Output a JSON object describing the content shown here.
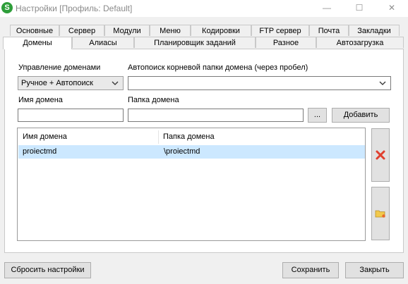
{
  "window": {
    "app_icon_letter": "S",
    "title": "Настройки [Профиль: Default]",
    "minimize_glyph": "—",
    "maximize_glyph": "☐",
    "close_glyph": "✕"
  },
  "tabs_row1": [
    "Основные",
    "Сервер",
    "Модули",
    "Меню",
    "Кодировки",
    "FTP сервер",
    "Почта",
    "Закладки"
  ],
  "tabs_row2": [
    "Домены",
    "Алиасы",
    "Планировщик заданий",
    "Разное",
    "Автозагрузка"
  ],
  "active_tab": "Домены",
  "form": {
    "domain_mgmt_label": "Управление доменами",
    "domain_mgmt_value": "Ручное + Автопоиск",
    "autosearch_label": "Автопоиск корневой папки домена (через пробел)",
    "autosearch_value": "",
    "domain_name_label": "Имя домена",
    "domain_name_value": "",
    "domain_folder_label": "Папка домена",
    "domain_folder_value": "",
    "browse_label": "...",
    "add_label": "Добавить"
  },
  "table": {
    "columns": [
      "Имя домена",
      "Папка домена"
    ],
    "rows": [
      {
        "name": "proiectmd",
        "folder": "\\proiectmd",
        "selected": true
      }
    ]
  },
  "footer": {
    "reset_label": "Сбросить настройки",
    "save_label": "Сохранить",
    "close_label": "Закрыть"
  },
  "colors": {
    "app_icon": "#2e9e3a",
    "selected_row": "#cce8ff",
    "delete_icon": "#e0402f",
    "folder_icon": "#f2c94c"
  }
}
